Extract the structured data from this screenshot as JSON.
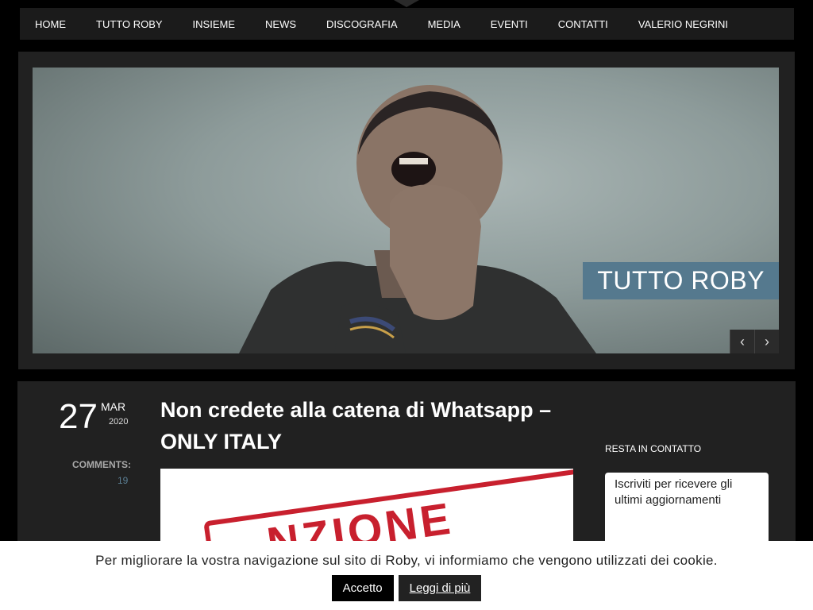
{
  "nav": {
    "items": [
      "HOME",
      "TUTTO ROBY",
      "INSIEME",
      "NEWS",
      "DISCOGRAFIA",
      "MEDIA",
      "EVENTI",
      "CONTATTI",
      "VALERIO NEGRINI"
    ]
  },
  "slider": {
    "caption": "TUTTO ROBY",
    "prev": "‹",
    "next": "›"
  },
  "post": {
    "day": "27",
    "month": "MAR",
    "year": "2020",
    "comments_label": "COMMENTS:",
    "comments_count": "19",
    "title": "Non credete alla catena di Whatsapp – ONLY ITALY",
    "stamp_text": "NZIONE"
  },
  "sidebar": {
    "title": "RESTA IN CONTATTO",
    "box_text": "Iscriviti per ricevere gli ultimi aggiornamenti"
  },
  "cookie": {
    "text": "Per migliorare la vostra navigazione sul sito di Roby, vi informiamo che vengono utilizzati dei cookie.",
    "accept": "Accetto",
    "more": "Leggi di più"
  },
  "colors": {
    "accent": "#55798e",
    "stamp": "#c8202e",
    "tab": "#0a9d4b"
  }
}
